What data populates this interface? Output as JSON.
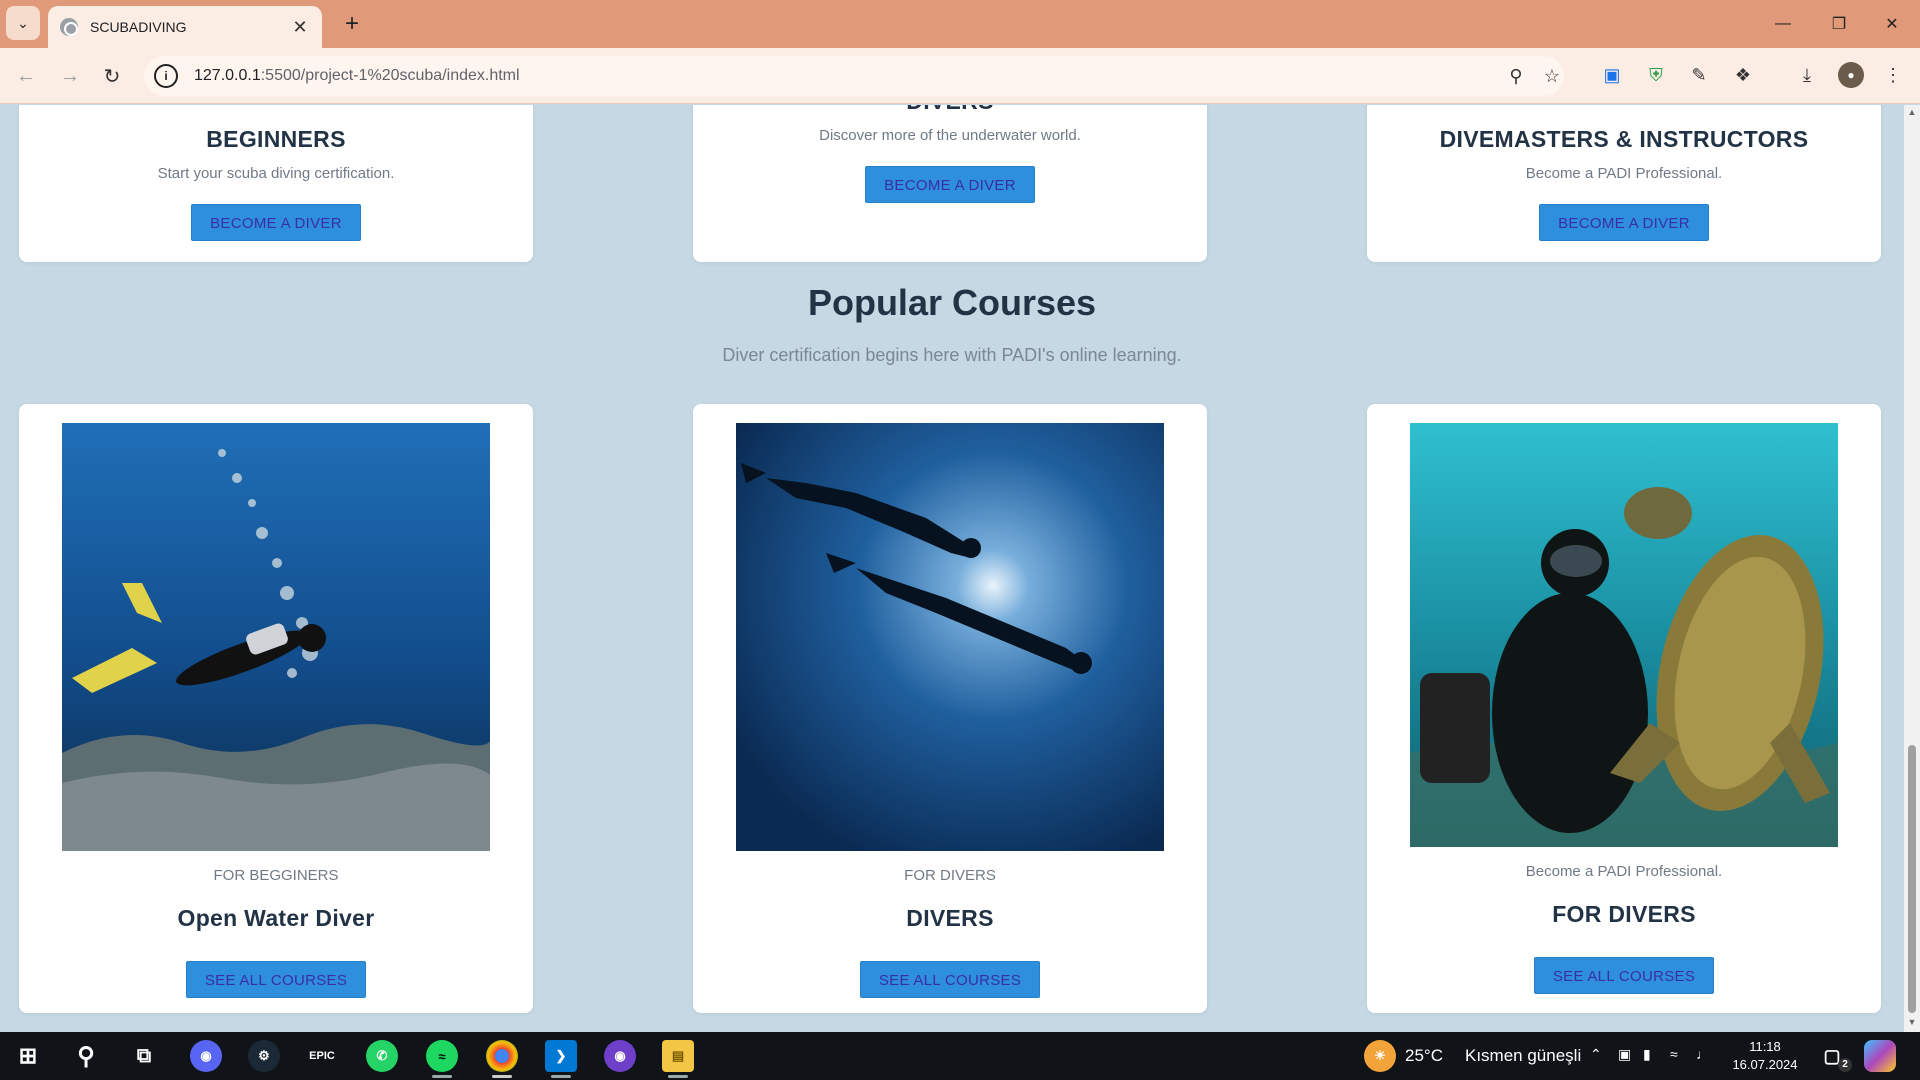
{
  "browser": {
    "tab_title": "SCUBADIVING",
    "url_host": "127.0.0.1",
    "url_rest": ":5500/project-1%20scuba/index.html"
  },
  "top_cards": [
    {
      "title": "BEGINNERS",
      "subtitle": "Start your scuba diving certification.",
      "button": "BECOME A DIVER"
    },
    {
      "title": "DIVERS",
      "subtitle": "Discover more of the underwater world.",
      "button": "BECOME A DIVER"
    },
    {
      "title": "DIVEMASTERS & INSTRUCTORS",
      "subtitle": "Become a PADI Professional.",
      "button": "BECOME A DIVER"
    }
  ],
  "popular": {
    "title": "Popular Courses",
    "subtitle": "Diver certification begins here with PADI's online learning."
  },
  "courses": [
    {
      "category": "FOR BEGGINERS",
      "title": "Open Water Diver",
      "button": "SEE ALL COURSES",
      "image": "diver-over-reef"
    },
    {
      "category": "FOR DIVERS",
      "title": "DIVERS",
      "button": "SEE ALL COURSES",
      "image": "two-divers-silhouette"
    },
    {
      "category": "Become a PADI Professional.",
      "title": "FOR DIVERS",
      "button": "SEE ALL COURSES",
      "image": "diver-with-turtle"
    }
  ],
  "taskbar": {
    "weather_temp": "25°C",
    "weather_text": "Kısmen güneşli",
    "time": "11:18",
    "date": "16.07.2024",
    "notification_count": "2",
    "epic_label": "EPIC"
  },
  "colors": {
    "page_bg": "#c5d8e4",
    "button_bg": "#2e8fdc",
    "button_text": "#3a2ea8",
    "heading": "#233346",
    "titlebar": "#e09a79"
  }
}
